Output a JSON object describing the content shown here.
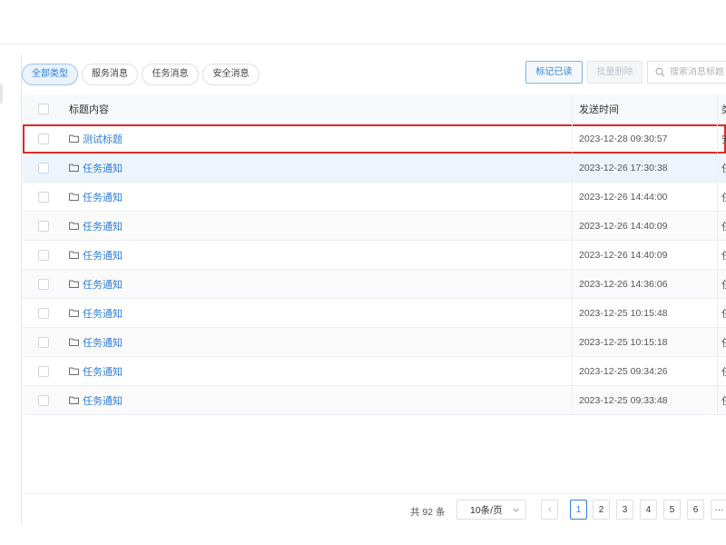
{
  "tabs": [
    {
      "label": "全部类型",
      "active": true
    },
    {
      "label": "服务消息",
      "active": false
    },
    {
      "label": "任务消息",
      "active": false
    },
    {
      "label": "安全消息",
      "active": false
    }
  ],
  "toolbar": {
    "mark_read_label": "标记已读",
    "batch_delete_label": "批量删除",
    "search_placeholder": "搜索消息标题"
  },
  "table": {
    "headers": {
      "title": "标题内容",
      "time": "发送时间",
      "type": "类"
    },
    "rows": [
      {
        "title": "测试标题",
        "time": "2023-12-28 09:30:57",
        "type": "安"
      },
      {
        "title": "任务通知",
        "time": "2023-12-26 17:30:38",
        "type": "任"
      },
      {
        "title": "任务通知",
        "time": "2023-12-26 14:44:00",
        "type": "任"
      },
      {
        "title": "任务通知",
        "time": "2023-12-26 14:40:09",
        "type": "任"
      },
      {
        "title": "任务通知",
        "time": "2023-12-26 14:40:09",
        "type": "任"
      },
      {
        "title": "任务通知",
        "time": "2023-12-26 14:36:06",
        "type": "任"
      },
      {
        "title": "任务通知",
        "time": "2023-12-25 10:15:48",
        "type": "任"
      },
      {
        "title": "任务通知",
        "time": "2023-12-25 10:15:18",
        "type": "任"
      },
      {
        "title": "任务通知",
        "time": "2023-12-25 09:34:26",
        "type": "任"
      },
      {
        "title": "任务通知",
        "time": "2023-12-25 09:33:48",
        "type": "任"
      }
    ]
  },
  "pagination": {
    "total_text": "共 92 条",
    "page_size": "10条/页",
    "pages": [
      "1",
      "2",
      "3",
      "4",
      "5",
      "6"
    ],
    "current_page": "1",
    "more": "···"
  },
  "colors": {
    "accent": "#2f7fd6",
    "highlight_border": "#d92d27"
  }
}
